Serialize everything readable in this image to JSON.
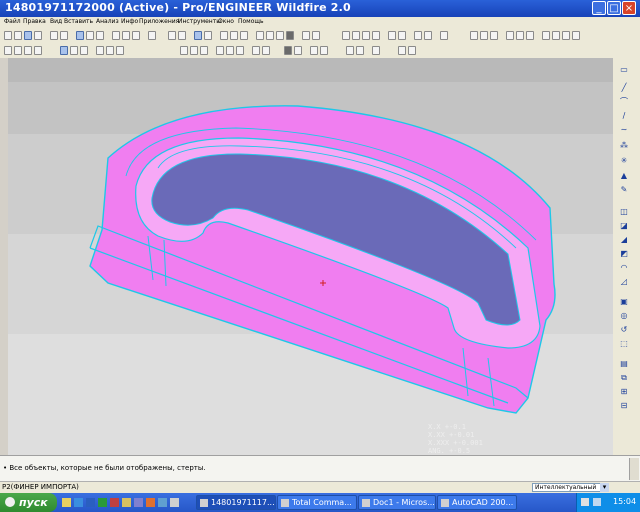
{
  "window": {
    "title": "14801971172000 (Active) - Pro/ENGINEER Wildfire 2.0",
    "buttons": {
      "minimize": "_",
      "maximize": "□",
      "close": "×"
    }
  },
  "menu": {
    "items": [
      "Файл",
      "Правка",
      "Вид",
      "Вставить",
      "Анализ",
      "Инфо",
      "Приложения",
      "Инструменты",
      "Окно",
      "Помощь"
    ]
  },
  "viewport": {
    "readout": {
      "line1": "X.X   +-0.1",
      "line2": "X.XX  +-0.01",
      "line3": "X.XXX +-0.001",
      "line4": "ANG. +-0.5"
    }
  },
  "message_area": {
    "message": "• Все объекты, которые не были отображены, стерты."
  },
  "status_bar": {
    "left_text": "P2(ФИНЕР ИМПОРТА)",
    "filter_value": "Интеллектуальный",
    "filter_arrow": "▾"
  },
  "taskbar": {
    "start_label": "пуск",
    "tasks": [
      {
        "label": "14801971117...",
        "active": true
      },
      {
        "label": "Total Comma...",
        "active": false
      },
      {
        "label": "Doc1 - Micros...",
        "active": false
      },
      {
        "label": "AutoCAD 200...",
        "active": false
      }
    ],
    "clock": "15:04"
  },
  "colors": {
    "part_fill": "#f07ef0",
    "part_edge": "#1ec8e8",
    "pocket_floor": "#6a6ab8"
  }
}
